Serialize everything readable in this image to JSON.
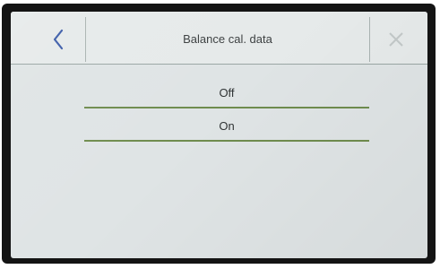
{
  "header": {
    "title": "Balance cal. data",
    "back_icon": "chevron-left-icon",
    "close_icon": "close-icon",
    "accent_color": "#3a5ba8"
  },
  "options": {
    "items": [
      {
        "label": "Off"
      },
      {
        "label": "On"
      }
    ],
    "underline_color": "#6f8c4e"
  }
}
